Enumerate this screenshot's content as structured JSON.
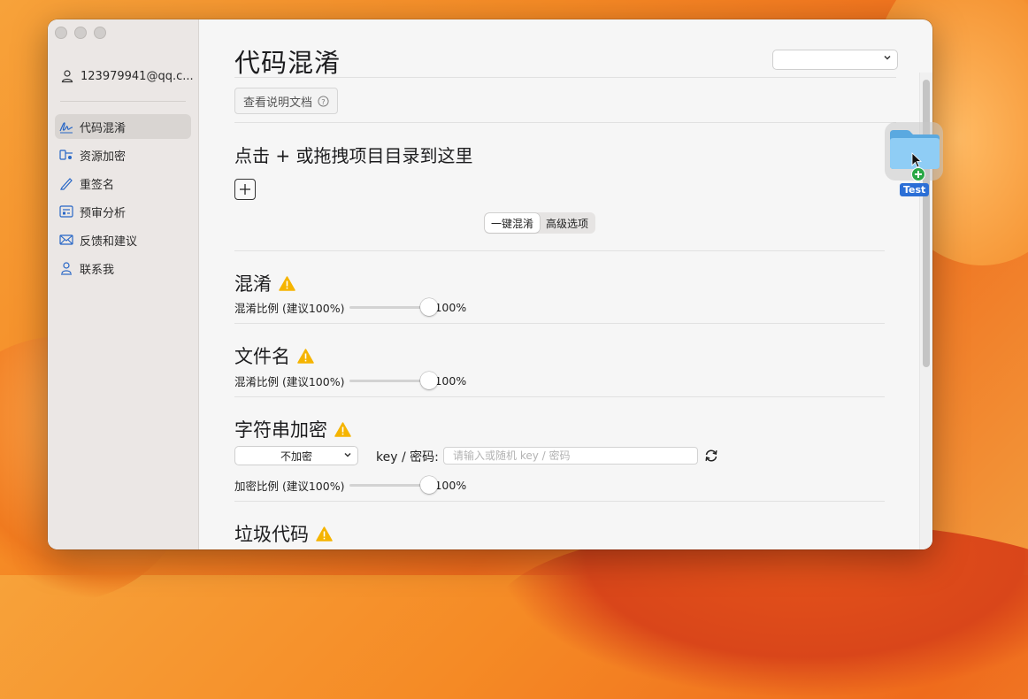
{
  "account": {
    "email": "123979941@qq.c..."
  },
  "sidebar": {
    "items": [
      {
        "label": "代码混淆",
        "icon": "signature-icon",
        "active": true
      },
      {
        "label": "资源加密",
        "icon": "key-icon"
      },
      {
        "label": "重签名",
        "icon": "pen-icon"
      },
      {
        "label": "预审分析",
        "icon": "report-icon"
      },
      {
        "label": "反馈和建议",
        "icon": "mail-icon"
      },
      {
        "label": "联系我",
        "icon": "contact-icon"
      }
    ]
  },
  "main": {
    "title": "代码混淆",
    "top_select_value": "",
    "doc_button": "查看说明文档",
    "drop_title": "点击 + 或拖拽项目目录到这里",
    "mode_tabs": [
      {
        "label": "一键混淆",
        "selected": true
      },
      {
        "label": "高级选项",
        "selected": false
      }
    ],
    "sections": {
      "obfuscate": {
        "title": "混淆",
        "slider_label": "混淆比例 (建议100%)",
        "value_text": "100%",
        "value": 100
      },
      "filename": {
        "title": "文件名",
        "slider_label": "混淆比例 (建议100%)",
        "value_text": "100%",
        "value": 100
      },
      "string_encrypt": {
        "title": "字符串加密",
        "encrypt_mode": "不加密",
        "key_label": "key / 密码:",
        "key_placeholder": "请输入或随机 key / 密码",
        "key_value": "",
        "slider_label": "加密比例 (建议100%)",
        "value_text": "100%",
        "value": 100
      },
      "junk_code": {
        "title": "垃圾代码"
      }
    }
  },
  "drag": {
    "label": "Test"
  },
  "colors": {
    "accent_blue": "#2b6fd6",
    "warning": "#f5b400",
    "badge_green": "#29a745"
  }
}
